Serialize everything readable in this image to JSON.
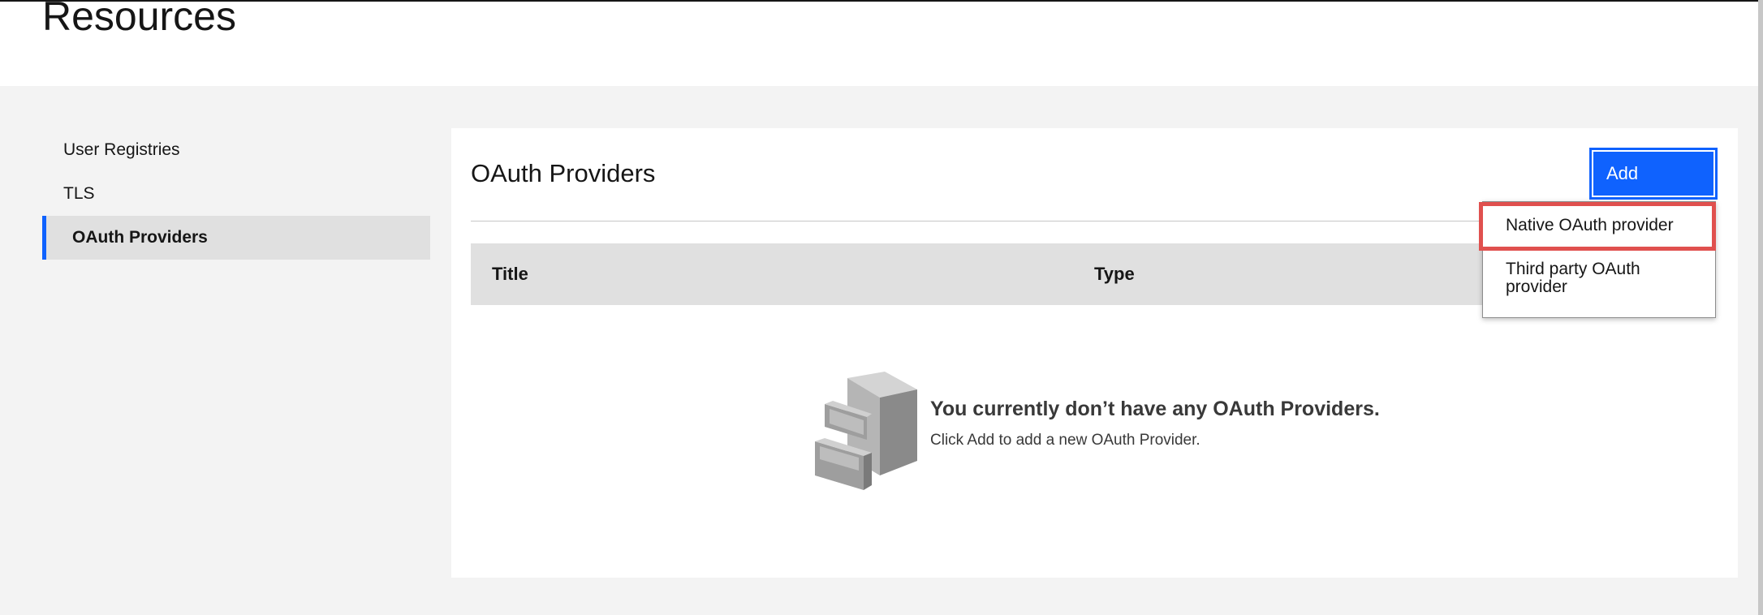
{
  "page": {
    "title": "Resources"
  },
  "sidebar": {
    "items": [
      {
        "label": "User Registries"
      },
      {
        "label": "TLS"
      },
      {
        "label": "OAuth Providers"
      }
    ]
  },
  "main": {
    "title": "OAuth Providers",
    "add_label": "Add",
    "table": {
      "columns": [
        "Title",
        "Type"
      ],
      "rows": []
    },
    "empty_state": {
      "heading": "You currently don’t have any OAuth Providers.",
      "subtext": "Click Add to add a new OAuth Provider."
    }
  },
  "add_menu": {
    "items": [
      {
        "label": "Native OAuth provider"
      },
      {
        "label": "Third party OAuth provider"
      }
    ]
  },
  "colors": {
    "accent": "#0f62fe",
    "highlight": "#e0504e",
    "background": "#f3f3f3"
  },
  "icons": {
    "empty_state": "filing-cabinet-icon"
  }
}
